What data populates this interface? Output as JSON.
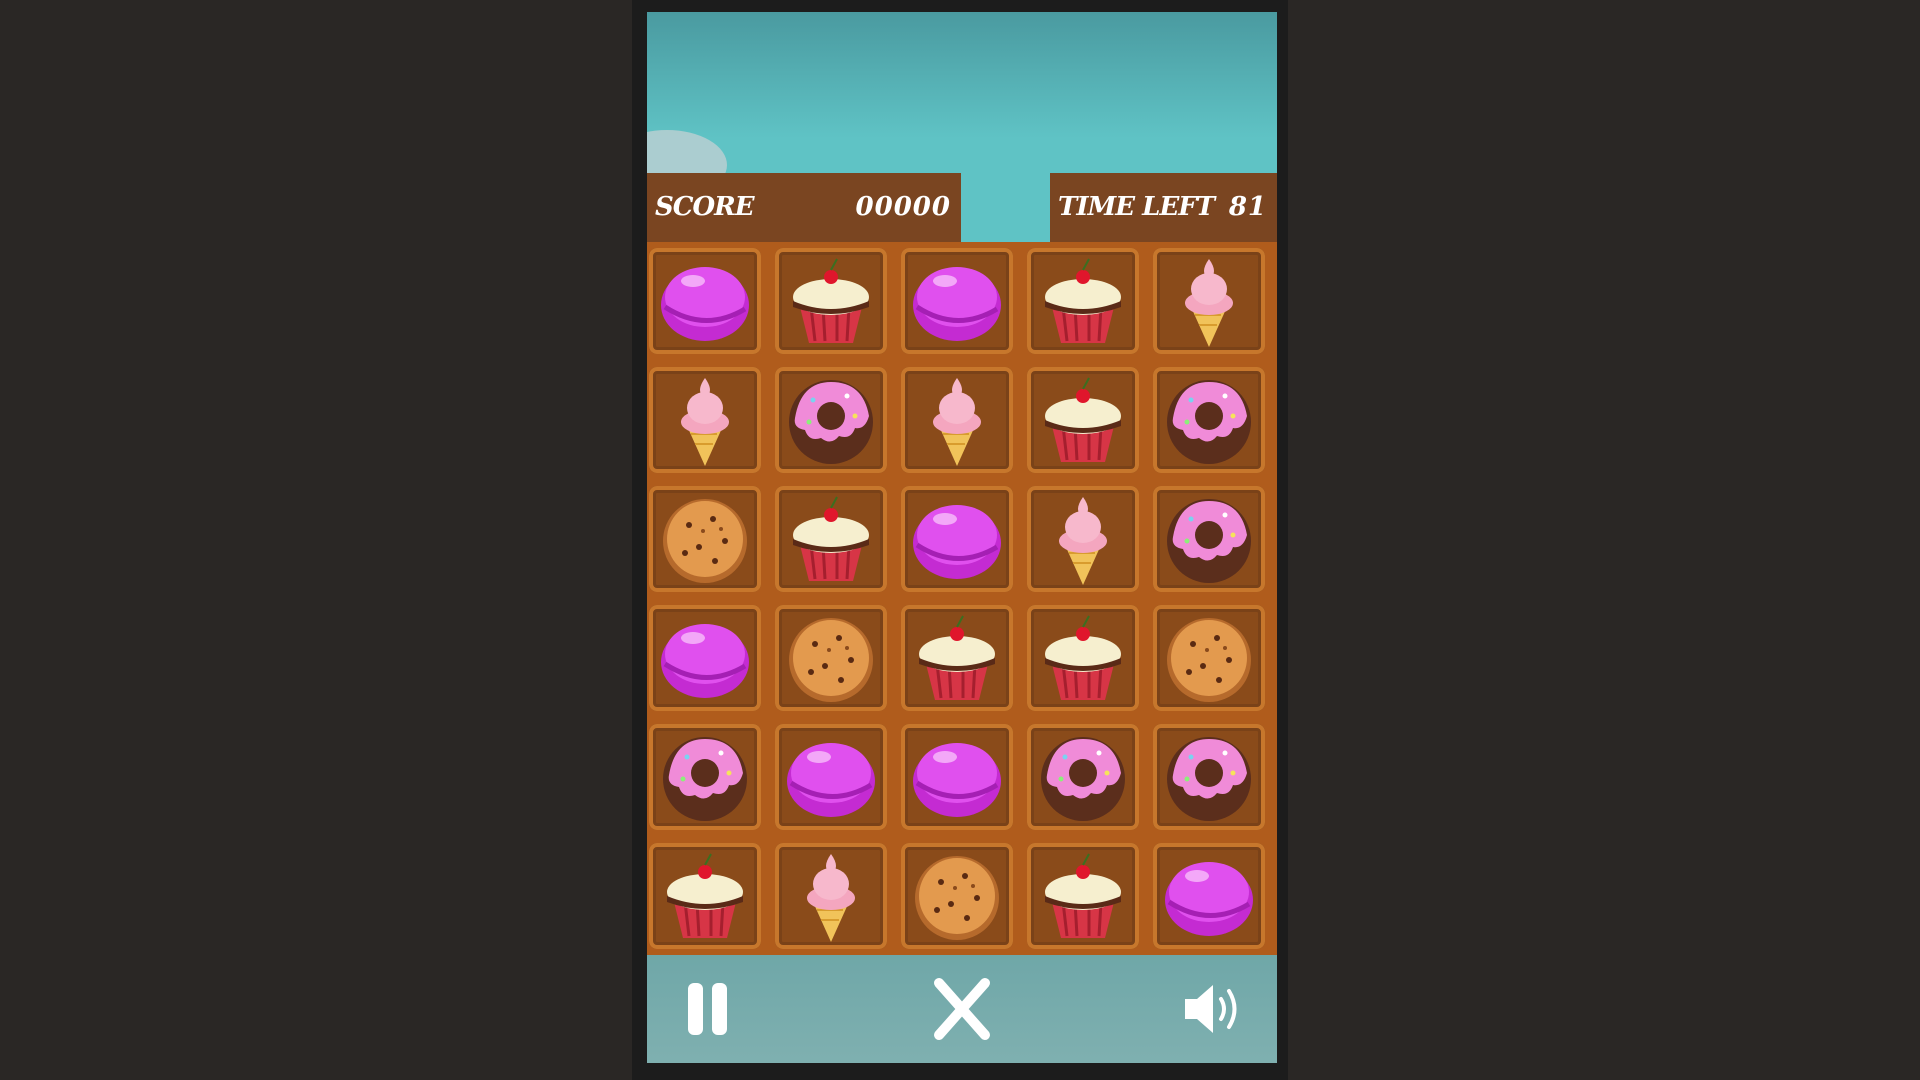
{
  "hud": {
    "score_label": "SCORE",
    "score_value": "00000",
    "time_label": "TIME LEFT",
    "time_value": "81"
  },
  "board": {
    "columns": 5,
    "rows": [
      [
        "macaron",
        "cupcake",
        "macaron",
        "cupcake",
        "icecream"
      ],
      [
        "icecream",
        "donut",
        "icecream",
        "cupcake",
        "donut"
      ],
      [
        "cookie",
        "cupcake",
        "macaron",
        "icecream",
        "donut"
      ],
      [
        "macaron",
        "cookie",
        "cupcake",
        "cupcake",
        "cookie"
      ],
      [
        "donut",
        "macaron",
        "macaron",
        "donut",
        "donut"
      ],
      [
        "cupcake",
        "icecream",
        "cookie",
        "cupcake",
        "macaron"
      ]
    ]
  },
  "controls": {
    "pause_icon": "pause-icon",
    "close_icon": "close-icon",
    "sound_icon": "speaker-icon"
  },
  "colors": {
    "hud_bg": "#7a4521",
    "board_bg": "#b05c1c",
    "sky": "#5fc3c5"
  }
}
